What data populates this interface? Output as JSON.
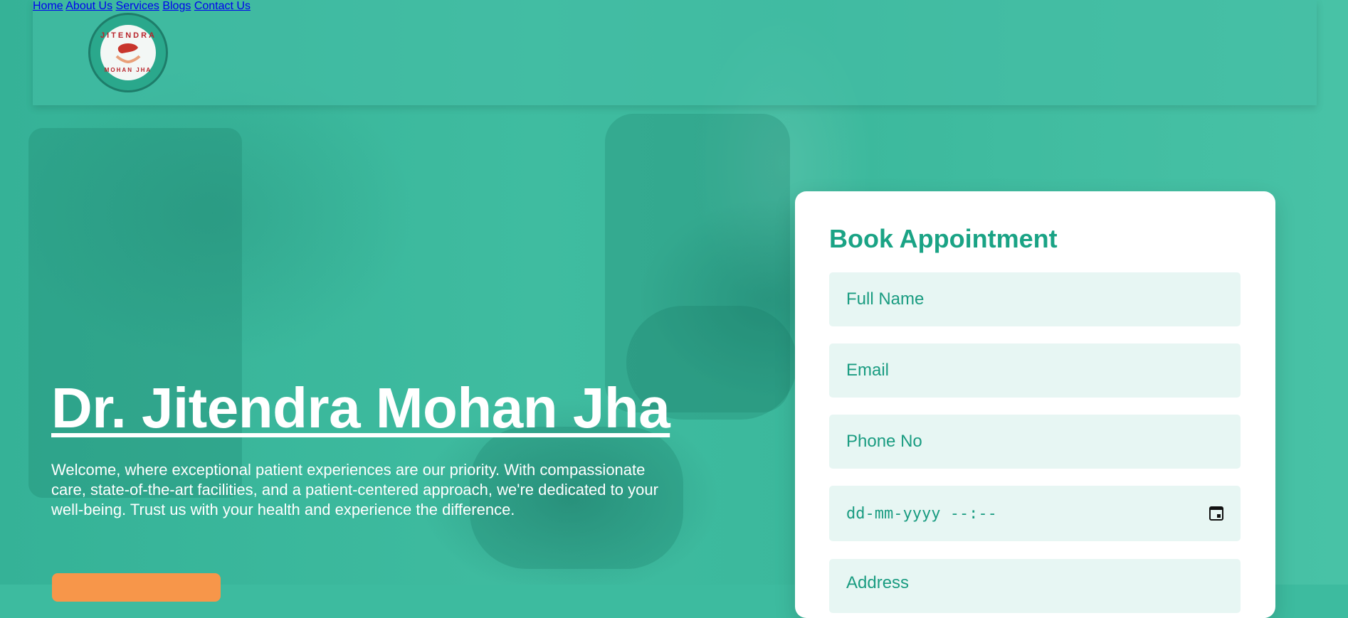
{
  "header": {
    "logo": {
      "top_text": "JITENDRA",
      "bottom_text": "MOHAN JHA"
    },
    "nav": [
      {
        "label": "Home"
      },
      {
        "label": "About Us"
      },
      {
        "label": "Services"
      },
      {
        "label": "Blogs"
      },
      {
        "label": "Contact Us"
      }
    ]
  },
  "hero": {
    "title": "Dr. Jitendra Mohan Jha",
    "description": "Welcome, where exceptional patient experiences are our priority. With compassionate care, state-of-the-art facilities, and a patient-centered approach, we're dedicated to your well-being. Trust us with your health and experience the difference.",
    "cta_label": ""
  },
  "appointment": {
    "title": "Book Appointment",
    "fields": {
      "full_name": "Full Name",
      "email": "Email",
      "phone": "Phone No",
      "datetime": "dd-mm-yyyy --:--",
      "address": "Address"
    }
  },
  "colors": {
    "brand_teal": "#1aa385",
    "background_teal": "#3dbb9f",
    "cta_orange": "#f7964a",
    "input_bg": "#e7f6f3"
  }
}
